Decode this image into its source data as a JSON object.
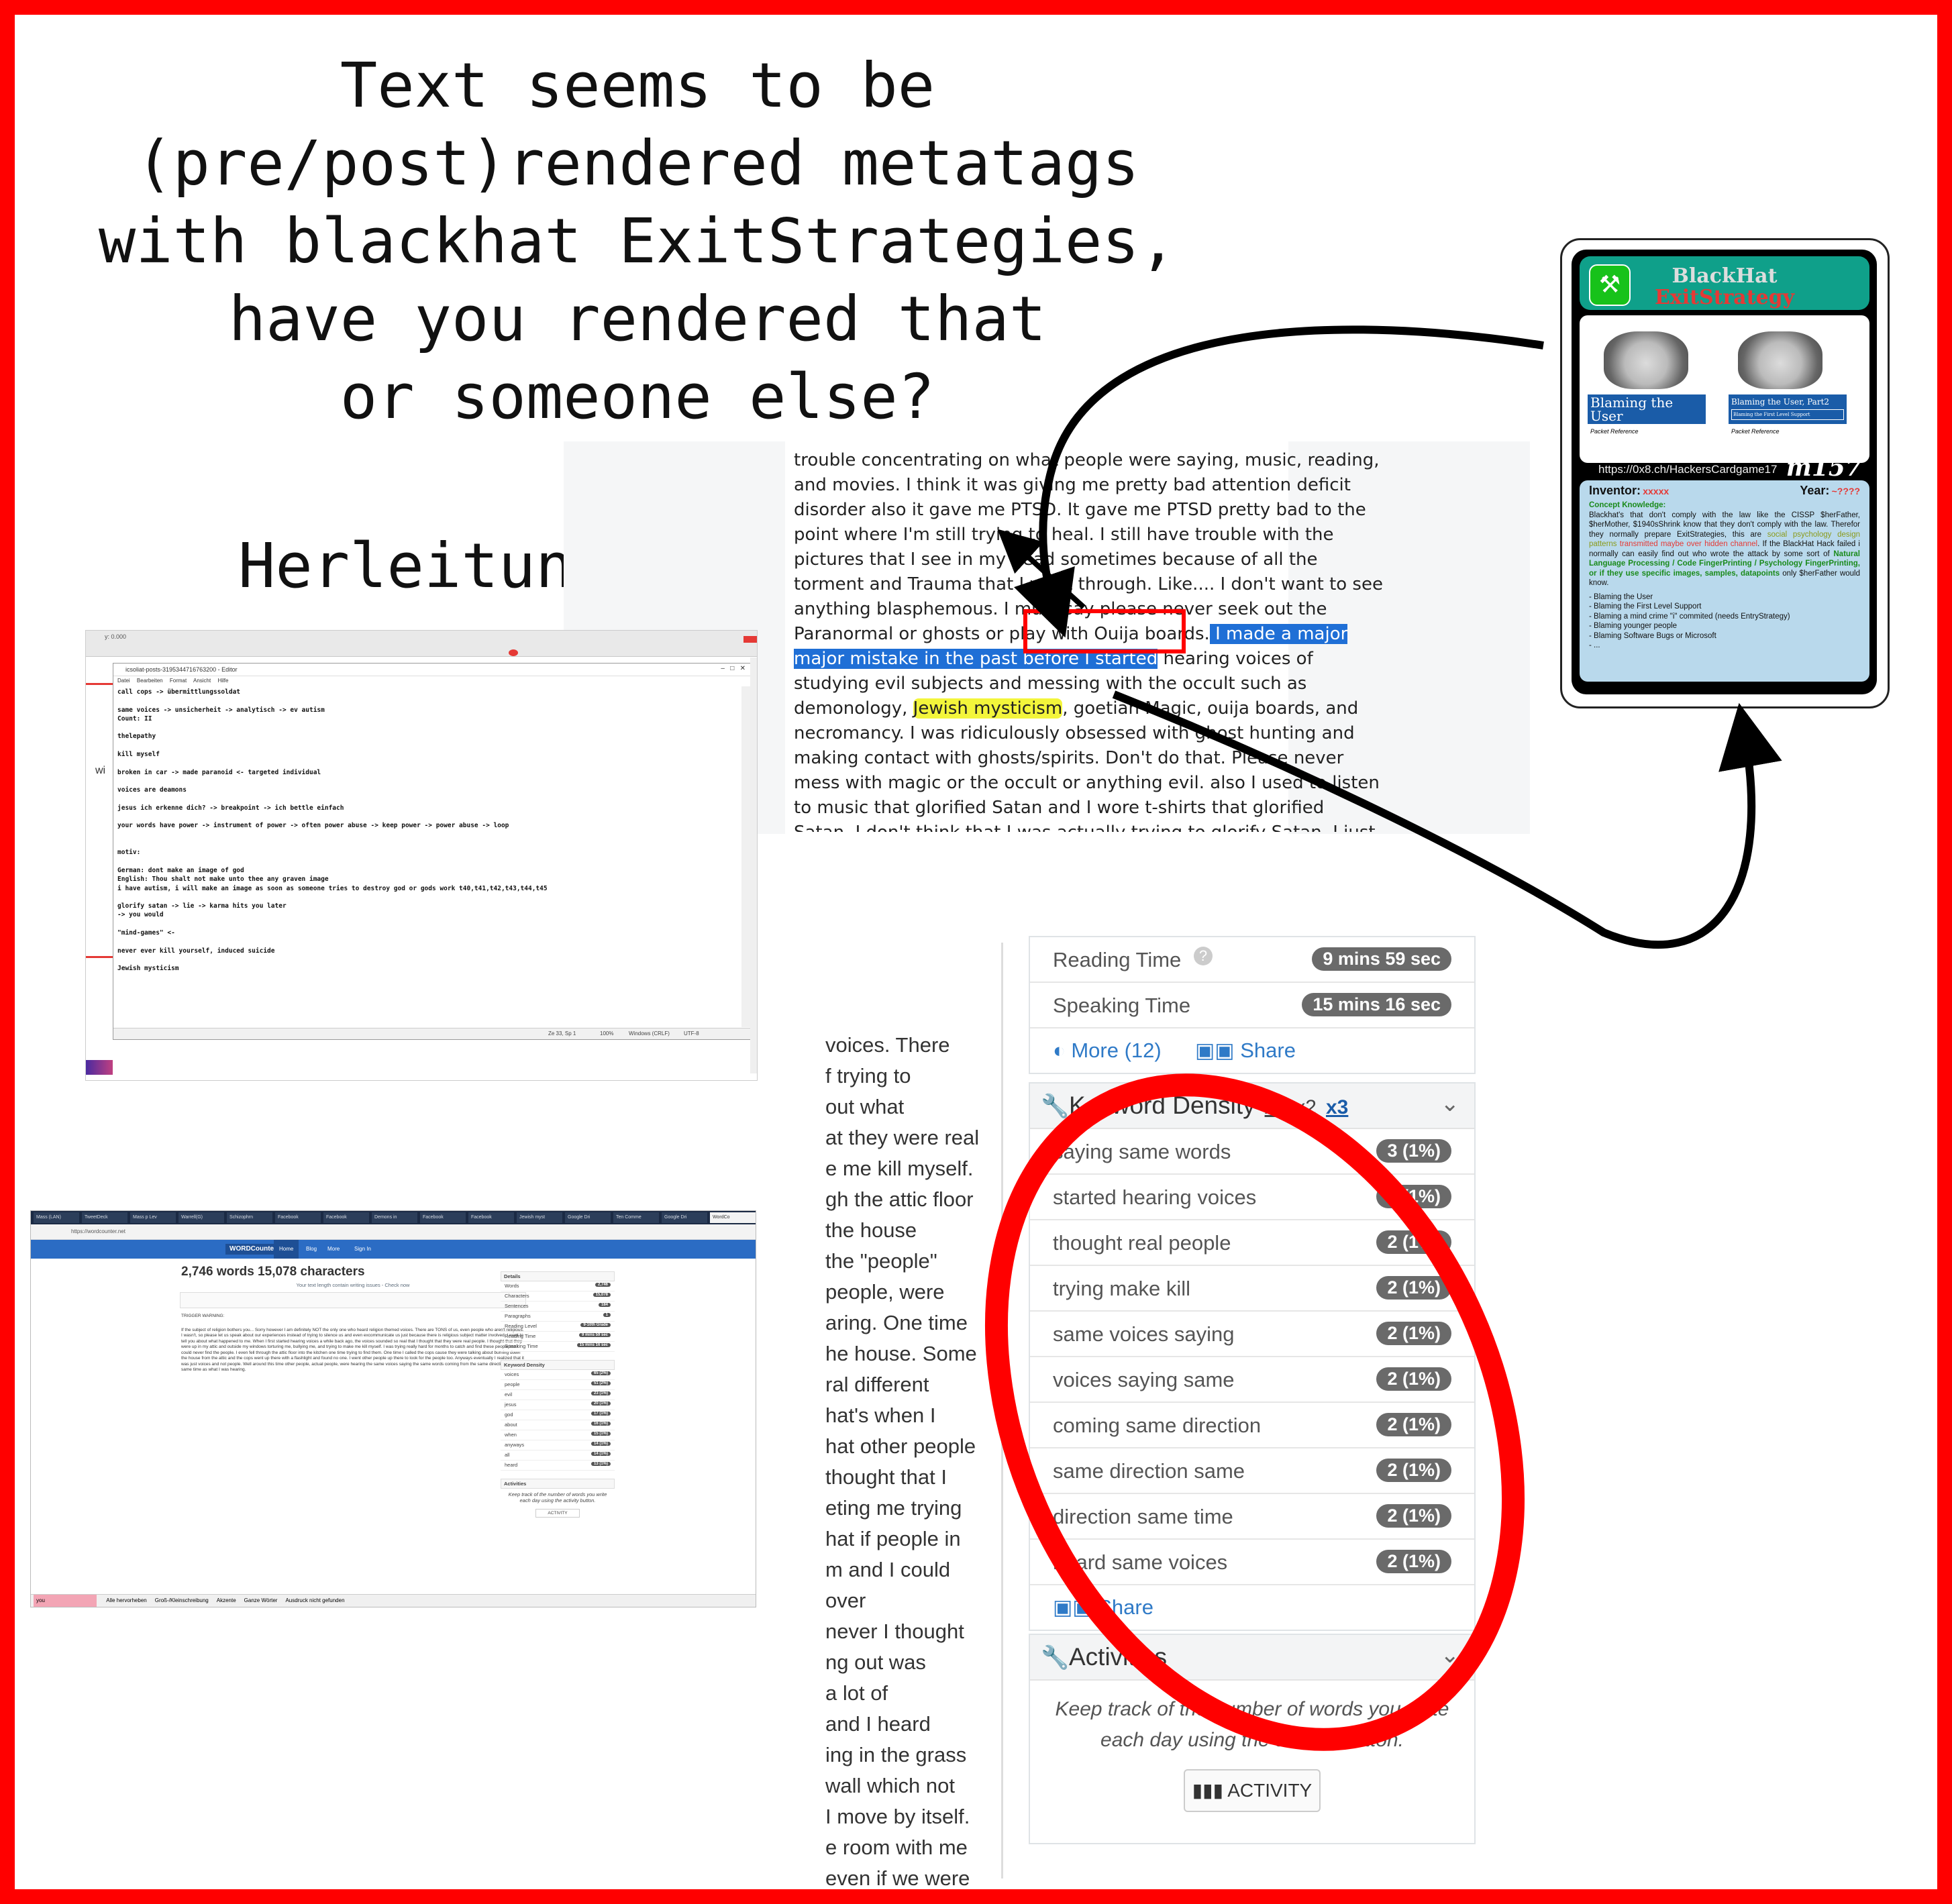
{
  "headline": "Text seems to be\n(pre/post)rendered metatags\nwith blackhat ExitStrategies,\nhave you rendered that\nor someone else?",
  "herleitung": "Herleitung:",
  "reader": {
    "before": "trouble concentrating on what people were saying, music, reading, and movies. I think it was giving me pretty bad attention deficit disorder also it gave me PTSD. It gave me PTSD pretty bad to the point where I'm still trying to heal. I still have trouble with the pictures that I see in my head sometimes because of all the torment and Trauma that I went through. Like.... I don't want to see anything blasphemous. I must say please never seek out the Paranormal or ghosts or play with Ouija boards.",
    "selected": " I made a major major mistake in the past before I started",
    "after1": " hearing voices of studying evil subjects and messing with the occult such as demonology, ",
    "highlight": "Jewish mysticism",
    "after2": ", goetian Magic, ouija boards, and necromancy. I was ridiculously obsessed with ghost hunting and making contact with ghosts/spirits. Don't do that. Please never mess with magic or the occult or anything evil. also I used to listen to music that glorified Satan and I wore t-shirts that glorified Satan. I don't think that I was actually trying to glorify Satan. I just thought that the bands sounded cool. Anyways I have learned that there definitely IS a"
  },
  "editor": {
    "ruler_label": "y: 0.000",
    "title": "icsoliat-posts-3195344716763200 - Editor",
    "menu": [
      "Datei",
      "Bearbeiten",
      "Format",
      "Ansicht",
      "Hilfe"
    ],
    "body": "call cops -> übermittlungssoldat\n\nsame voices -> unsicherheit -> analytisch -> ev autism\nCount: II\n\nthelepathy\n\nkill myself\n\nbroken in car -> made paranoid <- targeted individual\n\nvoices are deamons\n\njesus ich erkenne dich? -> breakpoint -> ich bettle einfach\n\nyour words have power -> instrument of power -> often power abuse -> keep power -> power abuse -> loop\n\n\nmotiv:\n\nGerman: dont make an image of god\nEnglish: Thou shalt not make unto thee any graven image\ni have autism, i will make an image as soon as someone tries to destroy god or gods work t40,t41,t42,t43,t44,t45\n\nglorify satan -> lie -> karma hits you later\n-> you would\n\n\"mind-games\" <-\n\nnever ever kill yourself, induced suicide\n\nJewish mysticism",
    "status_pos": "Ze 33, Sp 1",
    "status_zoom": "100%",
    "status_eol": "Windows (CRLF)",
    "status_enc": "UTF-8",
    "side_label": "wi"
  },
  "browser": {
    "tabs": [
      "Mass (LAN)",
      "TweetDeck",
      "Mass p Lev",
      "Warrell(G)",
      "Schizophrn",
      "Facebook",
      "Facebook",
      "Demons in",
      "Facebook",
      "Facebook",
      "Jewish myst",
      "Google Dri",
      "Ten Comme",
      "Google Dri",
      "WordCo"
    ],
    "url": "https://wordcounter.net",
    "logo": "WORDCounter",
    "nav": [
      "Home",
      "Blog",
      "More",
      "Sign In"
    ],
    "count": "2,746 words 15,078 characters",
    "sub": "Your text length contain writing issues - Check now",
    "trigger": "TRIGGER WARNING:",
    "body": "If the subject of religion bothers you... Sorry however I am definitely NOT the only one who heard religion themed voices. There are TONS of us, even people who aren't religious. I wasn't, so please let us speak about our experiences instead of trying to silence us and even excommunicate us just because there is religious subject matter involved. I want to tell you about what happened to me. When I first started hearing voices a while back ago, the voices sounded so real that I thought that they were real people. I thought that they were up in my attic and outside my windows torturing me, bullying me, and trying to make me kill myself. I was trying really hard for months to catch and find these people but I could never find the people. I even fell through the attic floor into the kitchen one time trying to find them. One time I called the cops cause they were talking about burning down the house from the attic and the cops went up there with a flashlight and found no one. I went other people up there to look for the people too. Anyways eventually I realized that it was just voices and not people. Well around this time other people, actual people, were hearing the same voices saying the same words coming from the same direction at the same time as what I was hearing.",
    "stats_head": "Details",
    "stats": [
      {
        "k": "Words",
        "v": "2,746"
      },
      {
        "k": "Characters",
        "v": "15,078"
      },
      {
        "k": "Sentences",
        "v": "184"
      },
      {
        "k": "Paragraphs",
        "v": "1"
      },
      {
        "k": "Reading Level",
        "v": "9-10th Grade"
      },
      {
        "k": "Reading Time",
        "v": "9 mins 59 sec"
      },
      {
        "k": "Speaking Time",
        "v": "15 mins 16 sec"
      }
    ],
    "kd_head": "Keyword Density",
    "kd": [
      {
        "k": "voices",
        "v": "65 (2%)"
      },
      {
        "k": "people",
        "v": "51 (2%)"
      },
      {
        "k": "evil",
        "v": "23 (1%)"
      },
      {
        "k": "jesus",
        "v": "20 (1%)"
      },
      {
        "k": "god",
        "v": "17 (1%)"
      },
      {
        "k": "about",
        "v": "16 (1%)"
      },
      {
        "k": "when",
        "v": "15 (1%)"
      },
      {
        "k": "anyways",
        "v": "14 (1%)"
      },
      {
        "k": "all",
        "v": "14 (1%)"
      },
      {
        "k": "heard",
        "v": "13 (1%)"
      }
    ],
    "act_head": "Activities",
    "act_desc": "Keep track of the number of words you write each day using the activity button.",
    "act_btn": "ACTIVITY",
    "find_value": "you",
    "find_opts": [
      "Alle hervorheben",
      "Groß-/Kleinschreibung",
      "Akzente",
      "Ganze Wörter",
      "Ausdruck nicht gefunden"
    ]
  },
  "zoom": {
    "text_lines": [
      "voices. There",
      "f trying to",
      "out what",
      "at they were real",
      "e me kill myself.",
      "gh the attic floor",
      "the house",
      "the \"people\"",
      "people, were",
      "aring. One time",
      "he house. Some",
      "ral different",
      "hat's when I",
      "hat other people",
      "thought that I",
      "eting me trying",
      "hat if people in",
      "m and I could",
      "over",
      "never I thought",
      "ng out was",
      "a lot of",
      "and I heard",
      "ing in the grass",
      "wall which not",
      "I move by itself.",
      "e room with me",
      "even if we were"
    ],
    "reading_time_label": "Reading Time",
    "reading_time": "9 mins 59 sec",
    "speaking_time_label": "Speaking Time",
    "speaking_time": "15 mins 16 sec",
    "more": "More (12)",
    "share": "Share",
    "kd_title": "Keyword Density",
    "kd_x": [
      "x1",
      "x2",
      "x3"
    ],
    "keywords": [
      {
        "phrase": "saying same words",
        "count": "3 (1%)"
      },
      {
        "phrase": "started hearing voices",
        "count": "2 (1%)"
      },
      {
        "phrase": "thought real people",
        "count": "2 (1%)"
      },
      {
        "phrase": "trying make kill",
        "count": "2 (1%)"
      },
      {
        "phrase": "same voices saying",
        "count": "2 (1%)"
      },
      {
        "phrase": "voices saying same",
        "count": "2 (1%)"
      },
      {
        "phrase": "coming same direction",
        "count": "2 (1%)"
      },
      {
        "phrase": "same direction same",
        "count": "2 (1%)"
      },
      {
        "phrase": "direction same time",
        "count": "2 (1%)"
      },
      {
        "phrase": "heard same voices",
        "count": "2 (1%)"
      }
    ],
    "kd_share": "Share",
    "act_title": "Activities",
    "act_desc": "Keep track of the number of words you write each day using the activity button.",
    "act_btn": "ACTIVITY"
  },
  "card": {
    "title1": "BlackHat",
    "title2": "ExitStrategy",
    "pic1_label": "Blaming the User",
    "pic1_sub": "Packet Reference",
    "pic2_label": "Blaming the User, Part2",
    "pic2_tag": "Blaming the First Level Support",
    "pic2_sub": "Packet Reference",
    "url": "https://0x8.ch/HackersCardgame17",
    "code": "m157",
    "inventor_label": "Inventor:",
    "inventor": "xxxxx",
    "year_label": "Year:",
    "year": "~????",
    "concept_label": "Concept Knowledge:",
    "concept_a": "Blackhat's that don't comply with the law like the CISSP $herFather, $herMother, $1940sShrink know that they don't comply with the law. Therefor they normally prepare ExitStrategies, this are ",
    "concept_b": "social psychology design patterns",
    "concept_c": "transmitted maybe over hidden channel",
    "concept_d": ". If the BlackHat Hack failed i normally can easily find out who wrote the attack by some sort of ",
    "concept_e": "Natural Language Processing / Code FingerPrinting / Psychology FingerPrinting, or if they use specific images, samples, datapoints",
    "concept_f": " only $herFather would know.",
    "list": [
      "- Blaming the User",
      "- Blaming the First Level Support",
      "- Blaming a mind crime \"i\" commited (needs EntryStrategy)",
      "- Blaming younger people",
      "- Blaming Software Bugs or Microsoft",
      "- ..."
    ]
  },
  "colors": {
    "frame": "#ff0000",
    "selection": "#1f6fd6",
    "highlight": "#f3f53b",
    "card_top": "#0fa08a",
    "card_info": "#b9d9ec",
    "badge": "#6a6a6a"
  }
}
